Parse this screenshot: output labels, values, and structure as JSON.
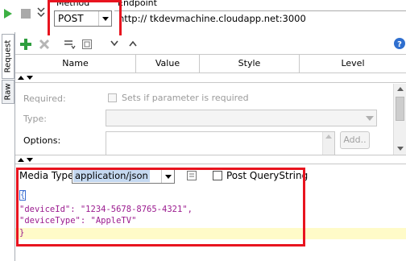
{
  "toolbar": {
    "method_label": "Method",
    "method_value": "POST",
    "endpoint_label": "Endpoint",
    "endpoint_value": "http:// tkdevmachine.cloudapp.net:3000"
  },
  "side_tabs": {
    "request": "Request",
    "raw": "Raw"
  },
  "params_table": {
    "columns": [
      "Name",
      "Value",
      "Style",
      "Level"
    ]
  },
  "param_details": {
    "required_label": "Required:",
    "required_checkbox_label": "Sets if parameter is required",
    "type_label": "Type:",
    "options_label": "Options:",
    "add_button": "Add.."
  },
  "body_bar": {
    "media_type_label": "Media Type",
    "media_type_value": "application/json",
    "post_querystring_label": "Post QueryString"
  },
  "body_editor": {
    "lines": [
      "{",
      "\"deviceId\": \"1234-5678-8765-4321\",",
      "\"deviceType\": \"AppleTV\"",
      "}"
    ]
  },
  "colors": {
    "highlight": "#e8141f",
    "json_text": "#9b1b8f",
    "selection": "#c5d9f1"
  }
}
